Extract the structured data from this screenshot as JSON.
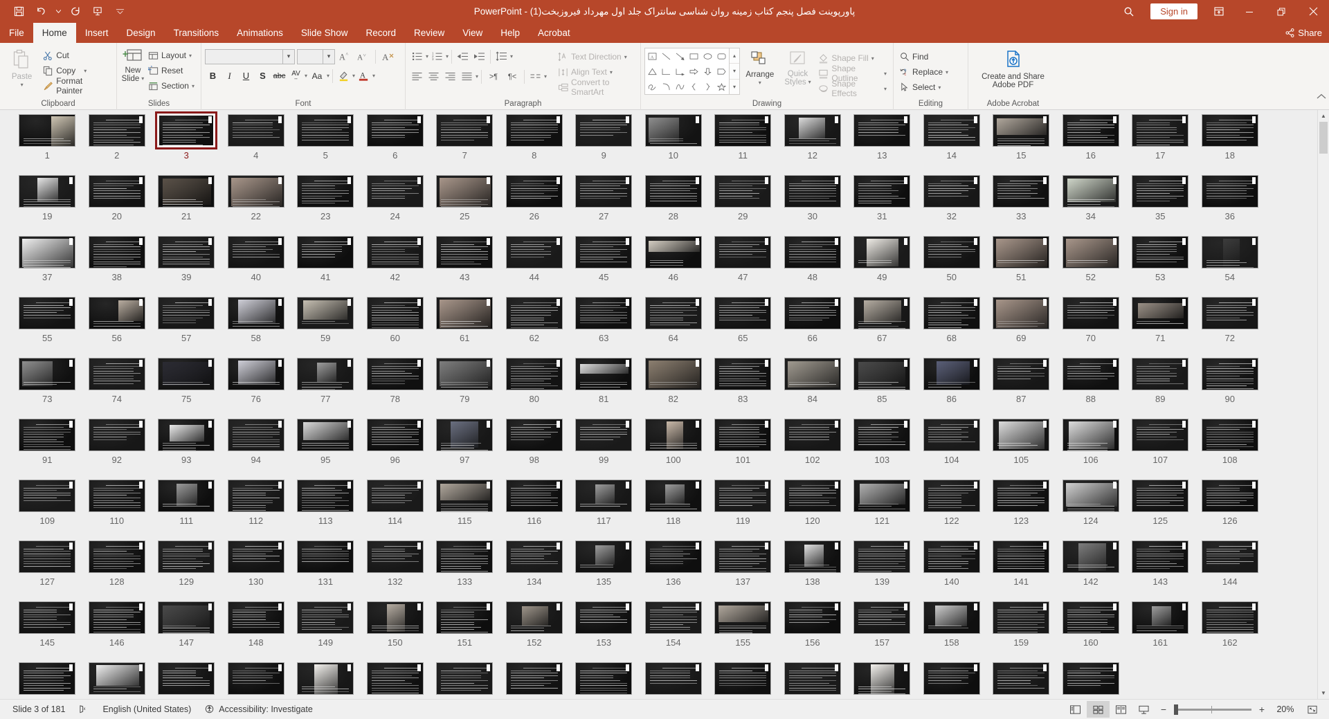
{
  "app": {
    "name": "PowerPoint",
    "title": "پاورپوینت فصل پنجم کتاب زمینه روان شناسی سانتراک جلد اول مهرداد فیروزبخت(1)",
    "title_full": "پاورپوینت فصل پنجم کتاب زمینه روان شناسی سانتراک جلد اول مهرداد فیروزبخت(1)  -  PowerPoint",
    "separator": "-"
  },
  "quick_access": {
    "items": [
      {
        "name": "save-icon",
        "label": "Save"
      },
      {
        "name": "undo-icon",
        "label": "Undo"
      },
      {
        "name": "redo-icon",
        "label": "Redo"
      },
      {
        "name": "start-presentation-icon",
        "label": "Start From Beginning"
      },
      {
        "name": "customize-qat-icon",
        "label": "Customize Quick Access Toolbar"
      }
    ]
  },
  "titlebar": {
    "search_label": "Search",
    "signin_label": "Sign in",
    "ribbon_display_label": "Ribbon Display Options",
    "minimize_label": "Minimize",
    "restore_label": "Restore Down",
    "close_label": "Close"
  },
  "tabs": [
    {
      "label": "File",
      "active": false
    },
    {
      "label": "Home",
      "active": true
    },
    {
      "label": "Insert",
      "active": false
    },
    {
      "label": "Design",
      "active": false
    },
    {
      "label": "Transitions",
      "active": false
    },
    {
      "label": "Animations",
      "active": false
    },
    {
      "label": "Slide Show",
      "active": false
    },
    {
      "label": "Record",
      "active": false
    },
    {
      "label": "Review",
      "active": false
    },
    {
      "label": "View",
      "active": false
    },
    {
      "label": "Help",
      "active": false
    },
    {
      "label": "Acrobat",
      "active": false
    }
  ],
  "share_label": "Share",
  "ribbon": {
    "clipboard": {
      "group_label": "Clipboard",
      "paste_label": "Paste",
      "cut_label": "Cut",
      "copy_label": "Copy",
      "format_painter_label": "Format Painter"
    },
    "slides": {
      "group_label": "Slides",
      "new_slide_label_1": "New",
      "new_slide_label_2": "Slide",
      "layout_label": "Layout",
      "reset_label": "Reset",
      "section_label": "Section"
    },
    "font": {
      "group_label": "Font",
      "font_name_value": "",
      "font_name_placeholder": "",
      "font_size_value": "",
      "grow_font_label": "Increase Font Size",
      "shrink_font_label": "Decrease Font Size",
      "clear_format_label": "Clear All Formatting",
      "bold_label": "B",
      "italic_label": "I",
      "underline_label": "U",
      "shadow_label": "S",
      "strikethrough_label": "abc",
      "spacing_label": "AV",
      "change_case_label": "Aa",
      "highlight_label": "Text Highlight Color",
      "font_color_label": "Font Color"
    },
    "paragraph": {
      "group_label": "Paragraph",
      "bullets_label": "Bullets",
      "numbering_label": "Numbering",
      "decrease_indent_label": "Decrease List Level",
      "increase_indent_label": "Increase List Level",
      "line_spacing_label": "Line Spacing",
      "align_left_label": "Align Left",
      "align_center_label": "Center",
      "align_right_label": "Align Right",
      "justify_label": "Justify",
      "ltr_label": "Left-to-Right Text Direction",
      "rtl_label": "Right-to-Left Text Direction",
      "columns_label": "Add or Remove Columns",
      "text_direction_label": "Text Direction",
      "align_text_label": "Align Text",
      "convert_smartart_label": "Convert to SmartArt"
    },
    "drawing": {
      "group_label": "Drawing",
      "arrange_label": "Arrange",
      "quick_styles_label_1": "Quick",
      "quick_styles_label_2": "Styles",
      "shape_fill_label": "Shape Fill",
      "shape_outline_label": "Shape Outline",
      "shape_effects_label": "Shape Effects",
      "shapes": [
        "text-box",
        "line",
        "arrow",
        "rectangle",
        "oval",
        "rounded-rectangle",
        "triangle",
        "elbow-connector",
        "elbow-arrow-connector",
        "block-arrow",
        "down-arrow",
        "pentagon-tag",
        "scribble",
        "arc",
        "curve",
        "left-brace",
        "right-brace",
        "star"
      ]
    },
    "editing": {
      "group_label": "Editing",
      "find_label": "Find",
      "replace_label": "Replace",
      "select_label": "Select"
    },
    "acrobat": {
      "group_label": "Adobe Acrobat",
      "create_share_label_1": "Create and Share",
      "create_share_label_2": "Adobe PDF"
    }
  },
  "sorter": {
    "selected_slide": 3,
    "columns": 18,
    "total_rendered": 178,
    "slide_kinds": {
      "1": "title-image",
      "10": "photo-left",
      "12": "chart-photo",
      "15": "photo-wide",
      "19": "chart-box",
      "21": "dark-photo",
      "22": "photo-full",
      "25": "photo-full",
      "34": "table-color",
      "37": "grid-table",
      "46": "image-band",
      "49": "doc-image",
      "51": "photo-full",
      "52": "photo-full",
      "54": "xray",
      "56": "photo-right",
      "58": "diagram",
      "59": "photo-multi",
      "61": "photo-full",
      "67": "photo-two",
      "69": "photo-full",
      "71": "photo-strip",
      "73": "photo-left",
      "75": "stars",
      "76": "diagram",
      "77": "photo-small",
      "79": "photo-texture",
      "81": "logo-row",
      "82": "texture",
      "84": "photo-noise",
      "85": "photo-dark",
      "86": "photo-blue",
      "93": "barcode",
      "95": "photo-line",
      "97": "photo-panel",
      "100": "photo-body",
      "105": "table-grid",
      "106": "table-grid",
      "111": "photo-round",
      "115": "photo-wide",
      "117": "photo-small",
      "118": "photo-small",
      "121": "photo-grid",
      "124": "photo-bw",
      "135": "photo-small",
      "138": "photo-x",
      "142": "photo-people",
      "147": "photo-dark",
      "150": "photo-tall",
      "152": "photo-oval",
      "155": "photo-wide",
      "158": "photo-fig",
      "161": "photo-small",
      "164": "grid-items",
      "167": "doc-page",
      "175": "doc-page"
    }
  },
  "status": {
    "slide_indicator": "Slide 3 of 181",
    "notes_icon_label": "Notes",
    "language": "English (United States)",
    "accessibility": "Accessibility: Investigate",
    "views": [
      {
        "name": "normal-view-button",
        "label": "Normal",
        "active": false
      },
      {
        "name": "slide-sorter-view-button",
        "label": "Slide Sorter",
        "active": true
      },
      {
        "name": "reading-view-button",
        "label": "Reading View",
        "active": false
      },
      {
        "name": "slide-show-button",
        "label": "Slide Show",
        "active": false
      }
    ],
    "zoom_out_label": "−",
    "zoom_in_label": "+",
    "zoom_percent": "20%",
    "fit_label": "Fit slide to current window"
  },
  "colors": {
    "brand": "#b7472a",
    "ribbon_bg": "#f5f4f2",
    "canvas_bg": "#eeeeee",
    "selection": "#8b1a1a",
    "accent_blue": "#1a6fc4"
  }
}
